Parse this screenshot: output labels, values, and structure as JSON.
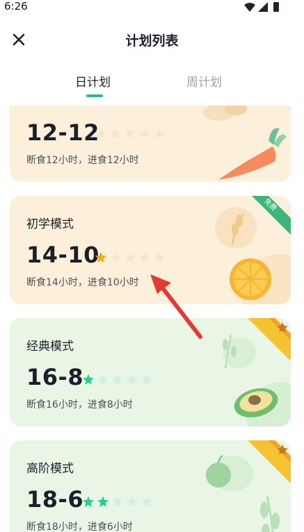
{
  "status": {
    "time": "6:26"
  },
  "header": {
    "title": "计划列表"
  },
  "tabs": [
    {
      "label": "日计划"
    },
    {
      "label": "周计划"
    }
  ],
  "colors": {
    "accent": "#2fb98a",
    "orange_star": "#f5a623",
    "green_star": "#2ecc8f",
    "badge_green": "#3fb47a",
    "badge_yellow": "#f5c332"
  },
  "plans": [
    {
      "name": "",
      "ratio": "12-12",
      "desc": "断食12小时，进食12小时",
      "difficulty": 0,
      "stars_total": 5,
      "badge": ""
    },
    {
      "name": "初学模式",
      "ratio": "14-10",
      "desc": "断食14小时，进食10小时",
      "difficulty": 1,
      "stars_total": 5,
      "badge": "免费"
    },
    {
      "name": "经典模式",
      "ratio": "16-8",
      "desc": "断食16小时，进食8小时",
      "difficulty": 1,
      "stars_total": 5,
      "badge": "star"
    },
    {
      "name": "高阶模式",
      "ratio": "18-6",
      "desc": "断食18小时，进食6小时",
      "difficulty": 2,
      "stars_total": 5,
      "badge": "star"
    }
  ]
}
